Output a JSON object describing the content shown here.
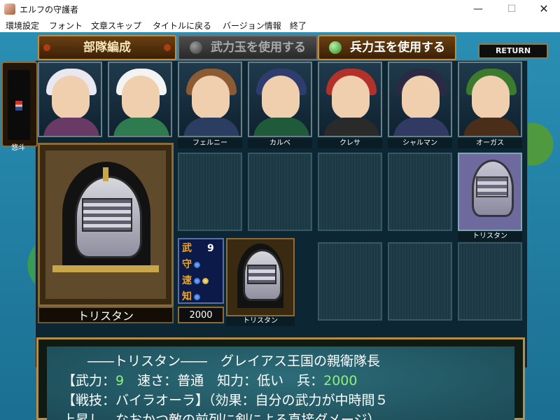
{
  "window": {
    "title": "エルフの守護者",
    "min": "—",
    "max": "☐",
    "close": "✕"
  },
  "menu": [
    "環境設定",
    "フォント",
    "文章スキップ",
    "タイトルに戻る",
    "バージョン情報",
    "終了"
  ],
  "tabs": {
    "unit": "部隊編成",
    "bu": "武力玉を使用する",
    "hei": "兵力玉を使用する"
  },
  "return_label": "RETURN",
  "leader": {
    "name": "悠斗"
  },
  "portraits": [
    {
      "name": "",
      "hair": "#e9e7ef",
      "body": "#6a3a67"
    },
    {
      "name": "",
      "hair": "#f3f3f3",
      "body": "#2d7b4f"
    },
    {
      "name": "フェルニー",
      "hair": "#8c5a33",
      "body": "#2b3d60"
    },
    {
      "name": "カルベ",
      "hair": "#2f3d6e",
      "body": "#1f5a3a"
    },
    {
      "name": "クレサ",
      "hair": "#b2312a",
      "body": "#2a2a2a"
    },
    {
      "name": "シャルマン",
      "hair": "#2a2a44",
      "body": "#303a63"
    },
    {
      "name": "オーガス",
      "hair": "#3c7a2e",
      "body": "#4a2e1a"
    }
  ],
  "slot_name": "トリスタン",
  "selected": {
    "name": "トリスタン",
    "troops": "2000",
    "stats": [
      {
        "label": "武",
        "value": "9",
        "dots": 0,
        "gold": 0
      },
      {
        "label": "守",
        "value": "",
        "dots": 1,
        "gold": 0
      },
      {
        "label": "速",
        "value": "",
        "dots": 1,
        "gold": 1
      },
      {
        "label": "知",
        "value": "",
        "dots": 1,
        "gold": 0
      }
    ]
  },
  "dialog": {
    "line1": "――トリスタン――　グレイアス王国の親衛隊長",
    "line2a": "【武力：",
    "line2b": "9",
    "line2c": "　速さ：普通　知力：低い　兵：",
    "line2d": "2000",
    "line3": "【戦技：バイラオーラ】（効果：自分の武力が中時間５",
    "line4": "上昇し、なおかつ敵の前列に剣による直接ダメージ）"
  }
}
